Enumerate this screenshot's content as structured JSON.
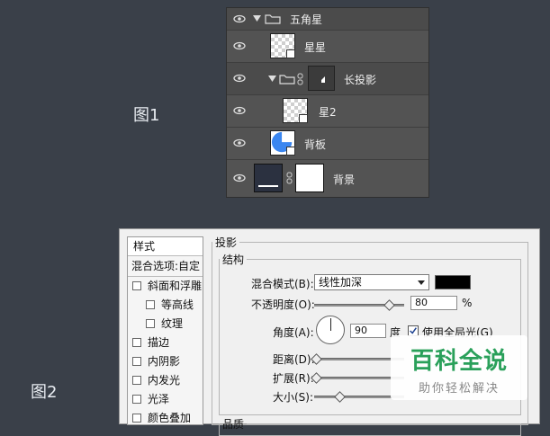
{
  "figure_labels": {
    "fig1": "图1",
    "fig2": "图2"
  },
  "layers": [
    {
      "name": "五角星",
      "type": "group"
    },
    {
      "name": "星星",
      "type": "layer"
    },
    {
      "name": "长投影",
      "type": "group"
    },
    {
      "name": "星2",
      "type": "layer"
    },
    {
      "name": "背板",
      "type": "layer"
    },
    {
      "name": "背景",
      "type": "layer"
    }
  ],
  "colors": {
    "accent_blue": "#3a86f0",
    "shadow_color": "#000000",
    "watermark_green": "#2aa05a"
  },
  "styles_panel": {
    "header": "样式",
    "blend_options": "混合选项:自定",
    "items": [
      "斜面和浮雕",
      "等高线",
      "纹理",
      "描边",
      "内阴影",
      "内发光",
      "光泽",
      "颜色叠加"
    ]
  },
  "drop_shadow": {
    "title": "投影",
    "structure": "结构",
    "blend_mode_label": "混合模式(B):",
    "blend_mode_value": "线性加深",
    "opacity_label": "不透明度(O):",
    "opacity_value": "80",
    "opacity_unit": "%",
    "opacity_fraction": 0.8,
    "angle_label": "角度(A):",
    "angle_value": "90",
    "angle_unit": "度",
    "global_light_label": "使用全局光(G)",
    "global_light_checked": true,
    "distance_label": "距离(D):",
    "spread_label": "扩展(R):",
    "size_label": "大小(S):",
    "quality": "品质"
  },
  "watermark": {
    "title": "百科全说",
    "subtitle": "助你轻松解决"
  }
}
